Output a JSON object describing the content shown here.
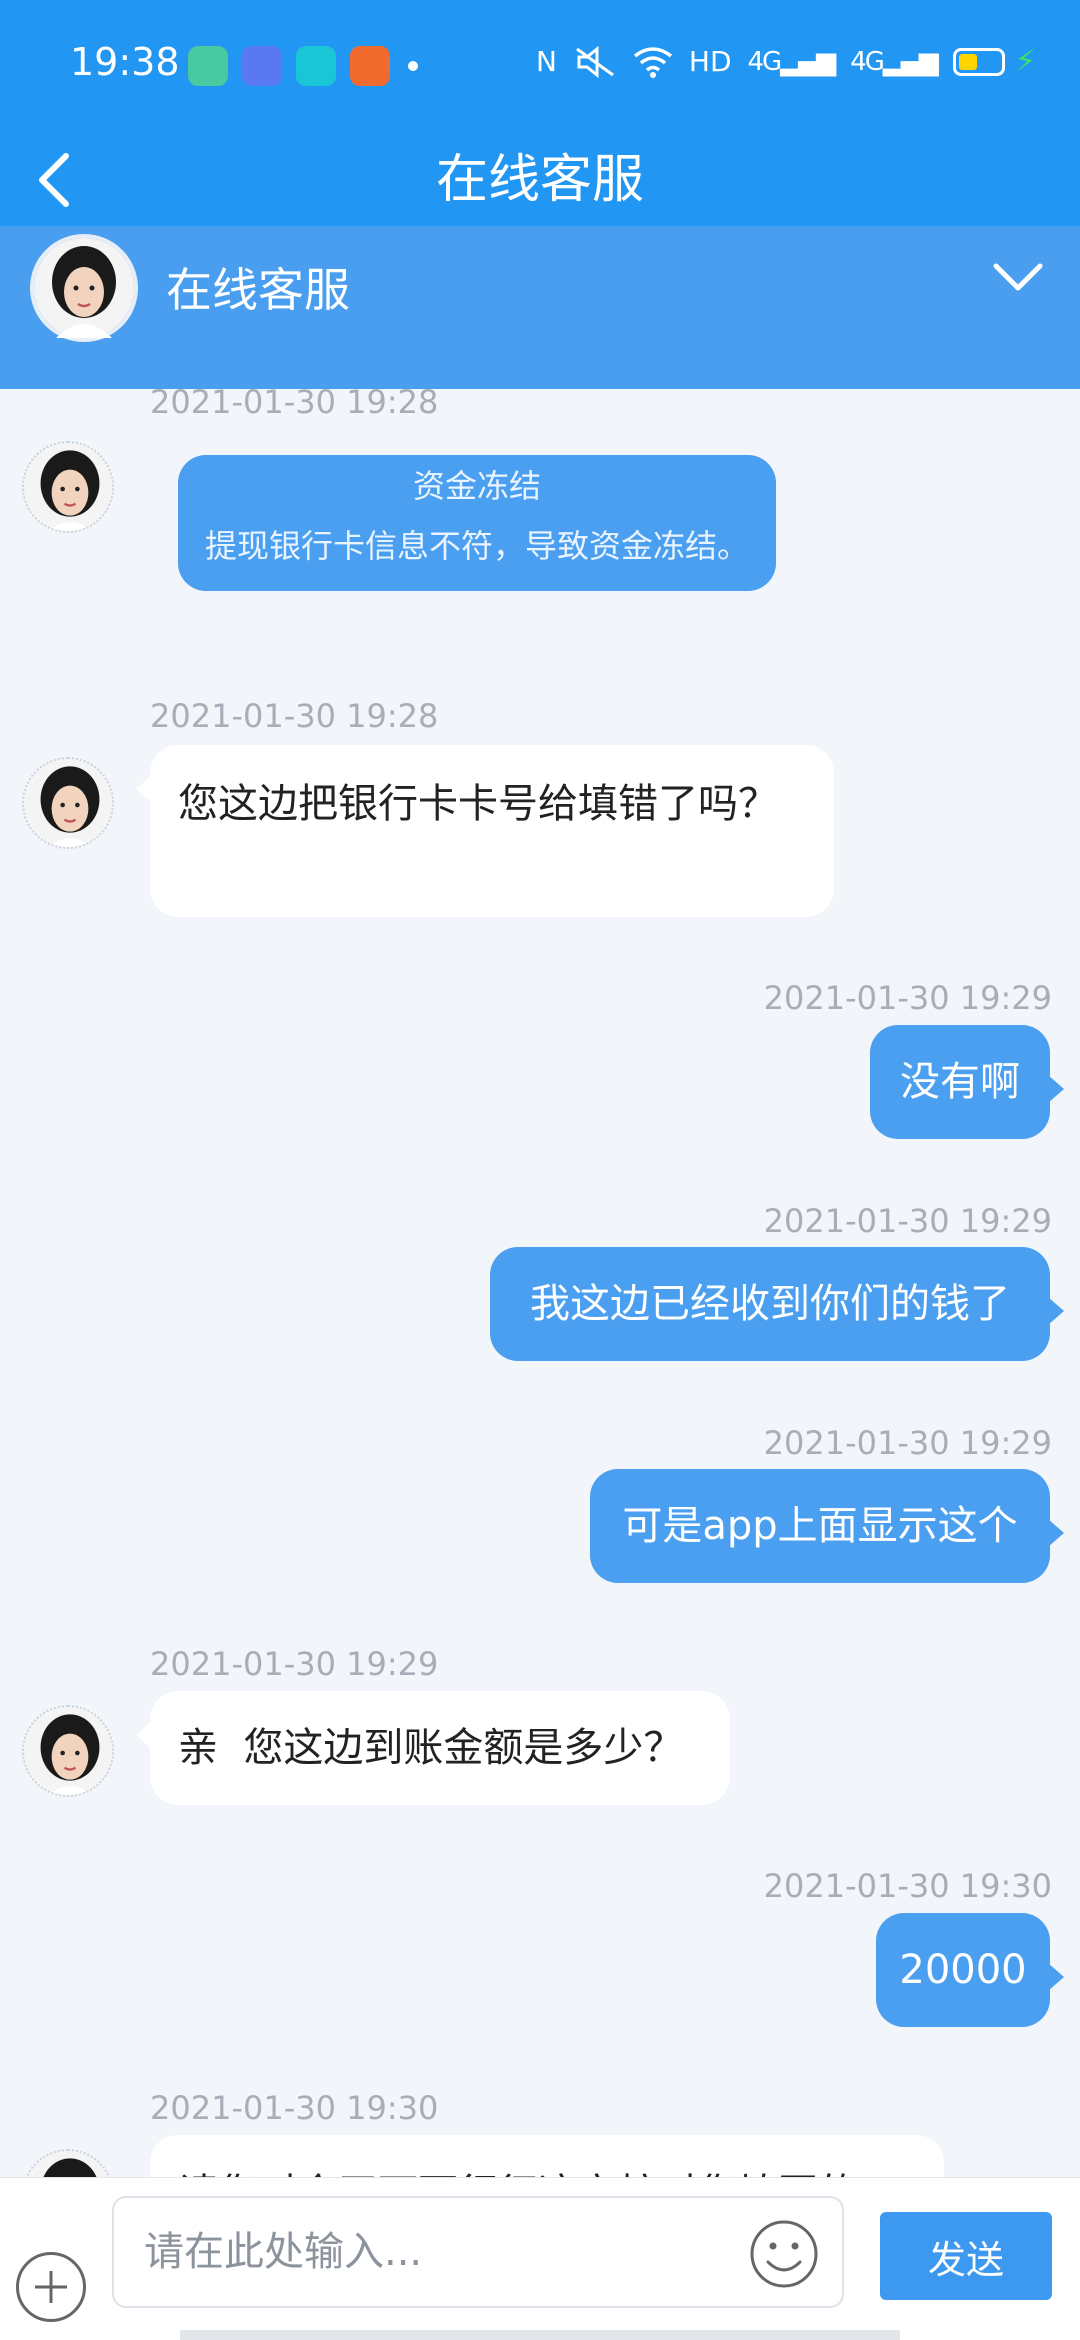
{
  "status_bar": {
    "time": "19:38",
    "nfc": "N",
    "hd": "HD",
    "signal1": "4G",
    "signal2": "4G",
    "battery_level": 0.45,
    "app_colors": [
      "#48c9a0",
      "#5a78f0",
      "#18c6d6",
      "#f26b2e"
    ]
  },
  "nav": {
    "title": "在线客服",
    "back_icon": "back-arrow-icon"
  },
  "agent": {
    "name": "在线客服",
    "expand_icon": "chevron-down-icon"
  },
  "messages": [
    {
      "time": "2021-01-30 19:28",
      "side": "in",
      "type": "notice",
      "title": "资金冻结",
      "text": "提现银行卡信息不符，导致资金冻结。"
    },
    {
      "time": "2021-01-30 19:28",
      "side": "in",
      "text": "您这边把银行卡卡号给填错了吗？"
    },
    {
      "time": "2021-01-30 19:29",
      "side": "out",
      "text": "没有啊"
    },
    {
      "time": "2021-01-30 19:29",
      "side": "out",
      "text": "我这边已经收到你们的钱了"
    },
    {
      "time": "2021-01-30 19:29",
      "side": "out",
      "text": "可是app上面显示这个"
    },
    {
      "time": "2021-01-30 19:29",
      "side": "in",
      "text": "亲  您这边到账金额是多少？"
    },
    {
      "time": "2021-01-30 19:30",
      "side": "out",
      "text": "20000"
    },
    {
      "time": "2021-01-30 19:30",
      "side": "in",
      "text": "请您对今天下面行征这安核对您填写的"
    }
  ],
  "input": {
    "placeholder": "请在此处输入...",
    "value": "",
    "send_label": "发送",
    "plus_icon": "plus-icon",
    "emoji_icon": "emoji-icon"
  },
  "colors": {
    "primary": "#2196f3",
    "header": "#4a9eef",
    "bubble_out": "#4a9ff0",
    "bubble_in": "#ffffff",
    "background": "#f2f5f9"
  }
}
